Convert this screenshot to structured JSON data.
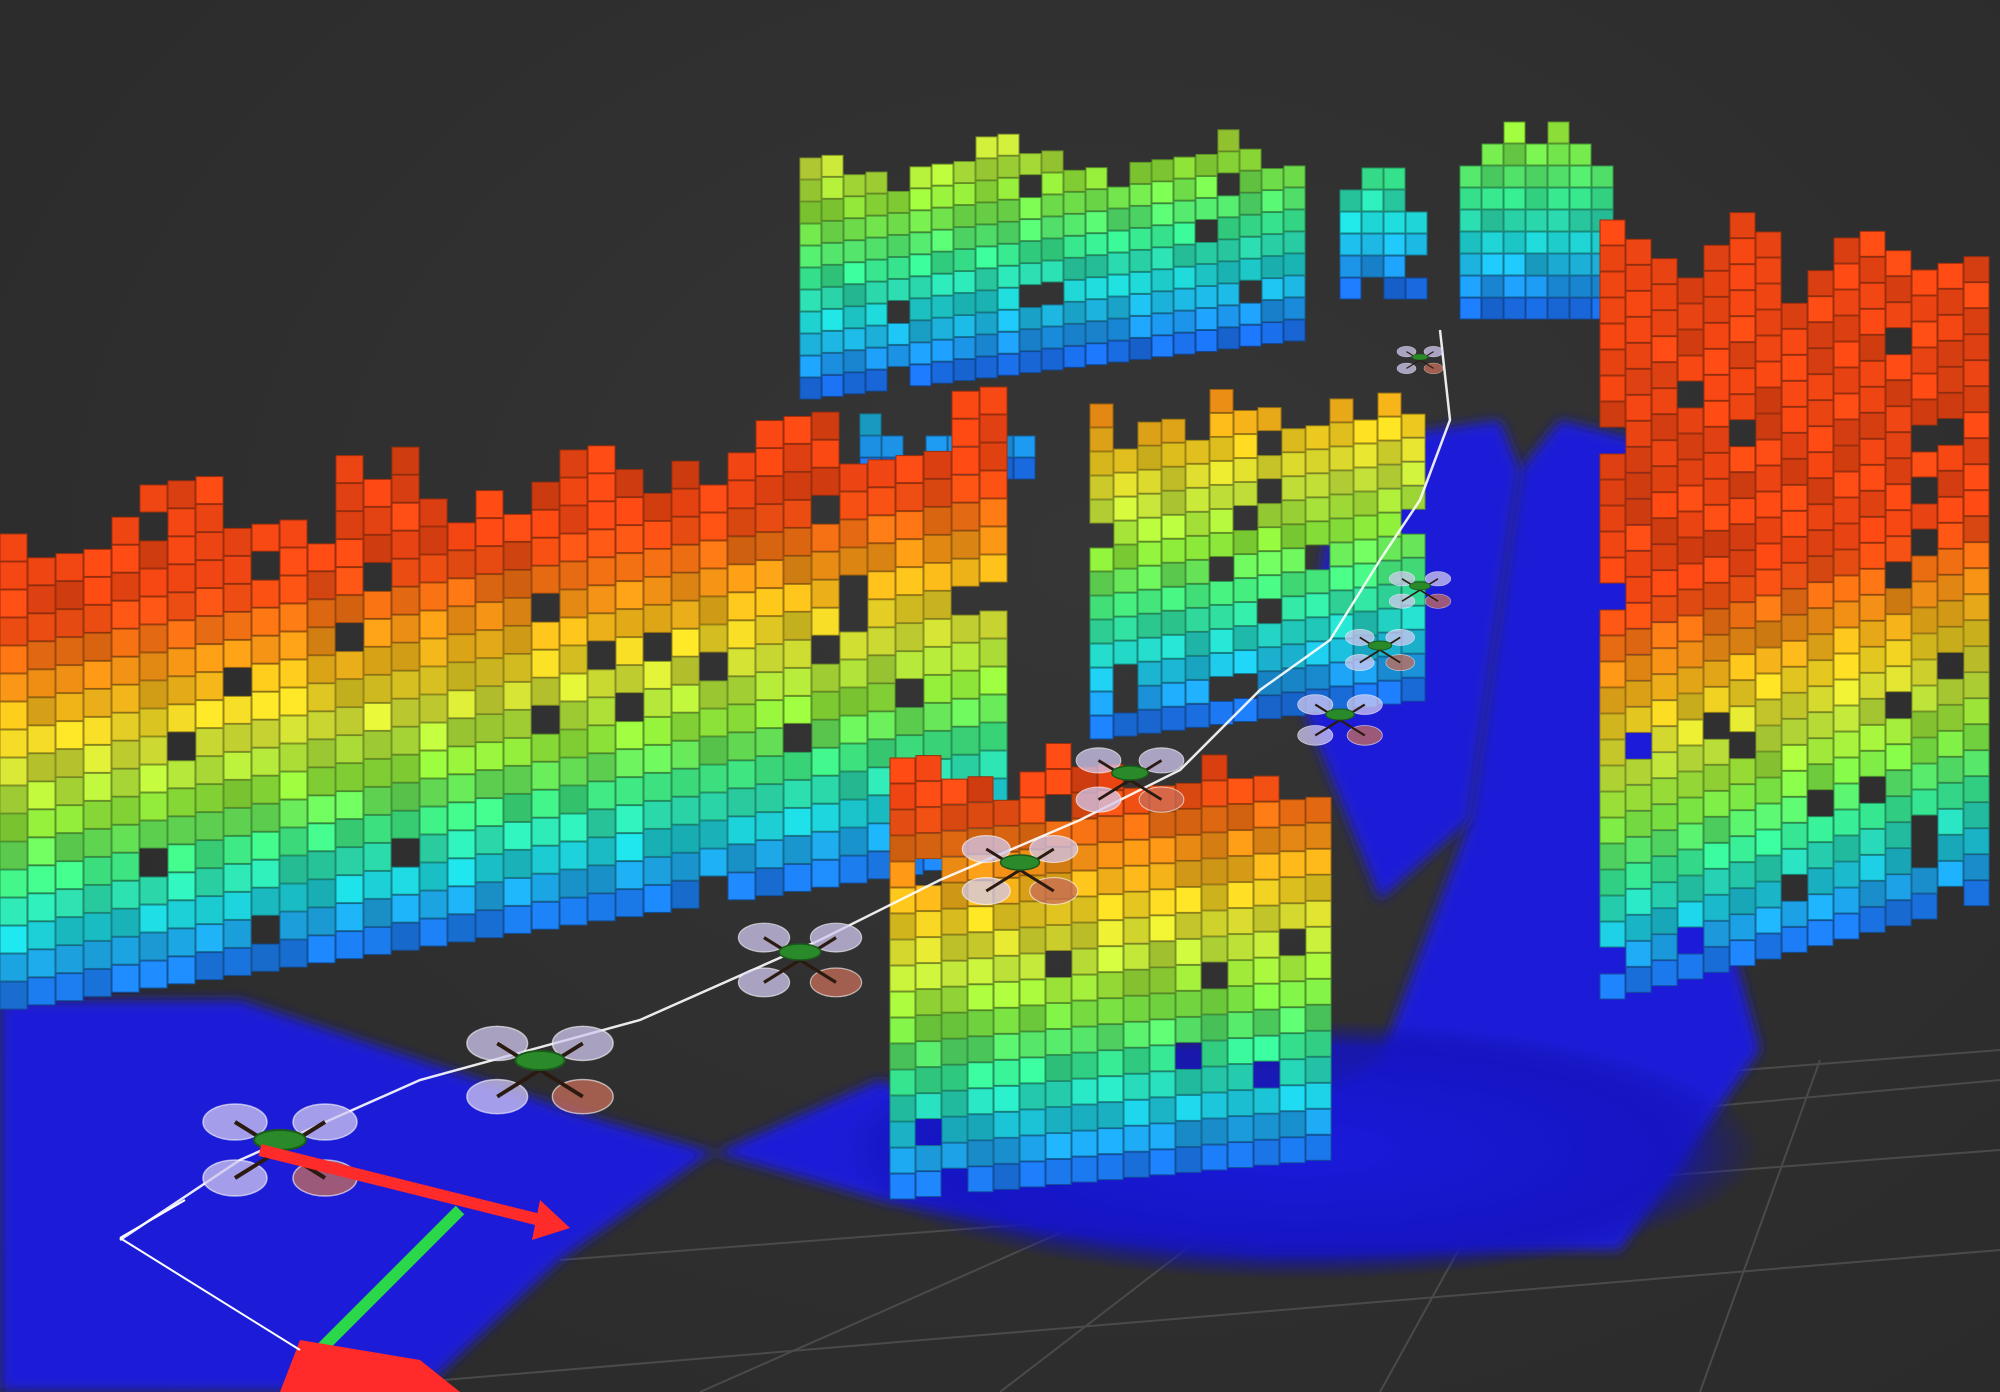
{
  "scene": {
    "background_color": "#2f2f2f",
    "grid_color": "#4a4a4a",
    "colormap": [
      "#1414d8",
      "#1e8cff",
      "#1ed8e0",
      "#3cf08c",
      "#8cf03c",
      "#d2f03c",
      "#ffd21e",
      "#ff8c14",
      "#ff4a14"
    ],
    "axes": {
      "x_color": "#ff2a2a",
      "y_color": "#2ad84a"
    },
    "drones": {
      "count": 9,
      "icon": "quadrotor-icon"
    },
    "trajectory_color": "#ffffff"
  }
}
